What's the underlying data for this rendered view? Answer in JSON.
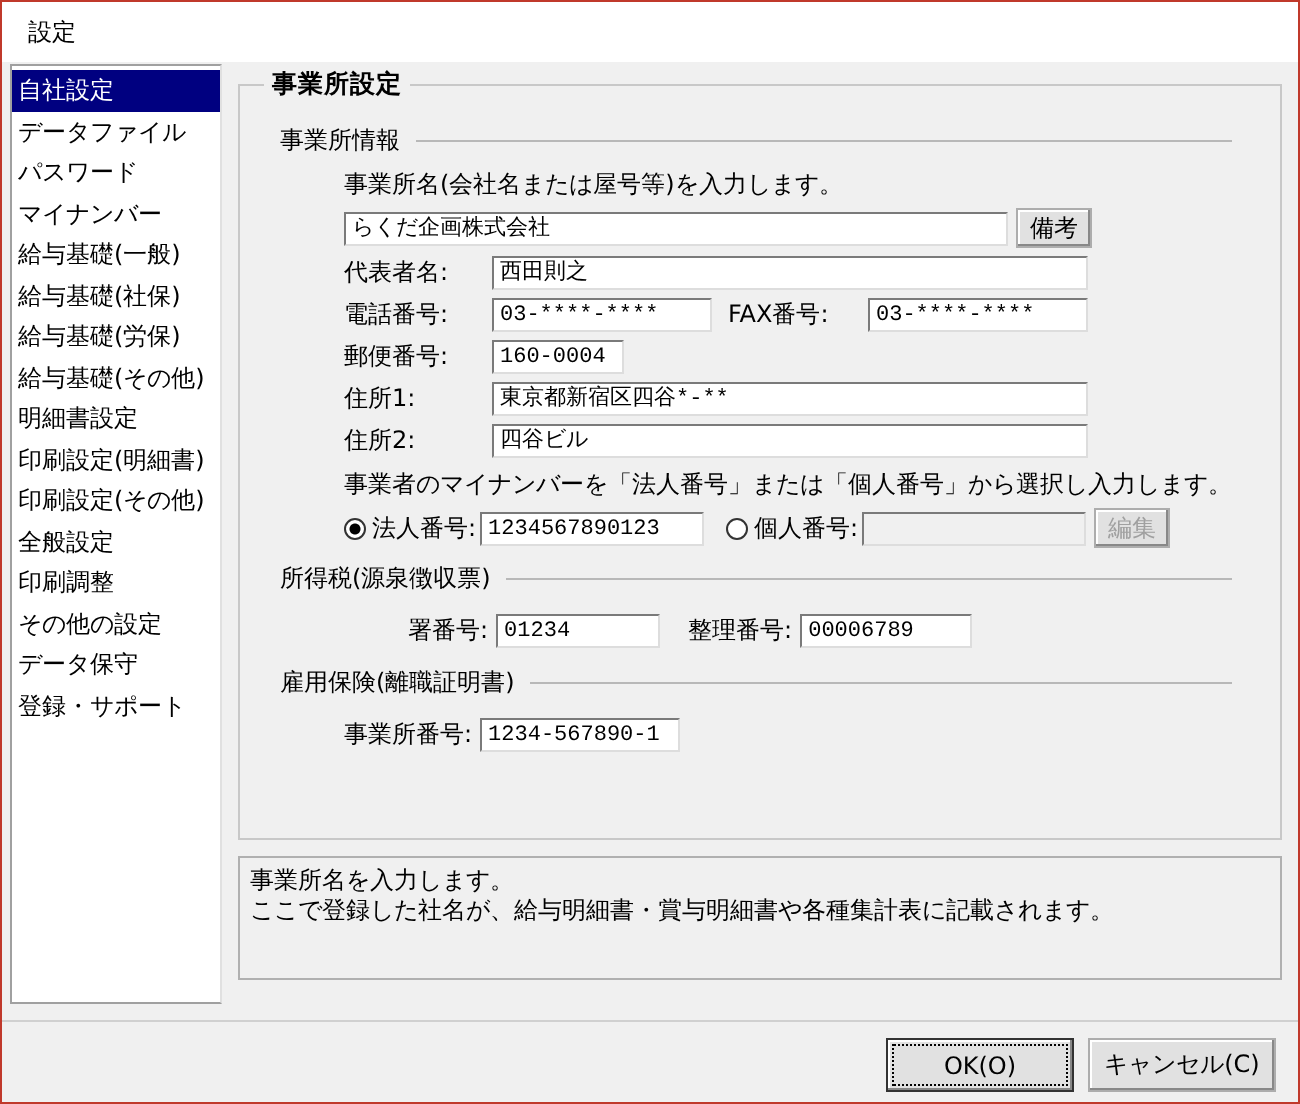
{
  "window": {
    "title": "設定"
  },
  "sidebar": {
    "items": [
      {
        "label": "自社設定",
        "selected": true
      },
      {
        "label": "データファイル",
        "selected": false
      },
      {
        "label": "パスワード",
        "selected": false
      },
      {
        "label": "マイナンバー",
        "selected": false
      },
      {
        "label": "給与基礎(一般)",
        "selected": false
      },
      {
        "label": "給与基礎(社保)",
        "selected": false
      },
      {
        "label": "給与基礎(労保)",
        "selected": false
      },
      {
        "label": "給与基礎(その他)",
        "selected": false
      },
      {
        "label": "明細書設定",
        "selected": false
      },
      {
        "label": "印刷設定(明細書)",
        "selected": false
      },
      {
        "label": "印刷設定(その他)",
        "selected": false
      },
      {
        "label": "全般設定",
        "selected": false
      },
      {
        "label": "印刷調整",
        "selected": false
      },
      {
        "label": "その他の設定",
        "selected": false
      },
      {
        "label": "データ保守",
        "selected": false
      },
      {
        "label": "登録・サポート",
        "selected": false
      }
    ]
  },
  "panel": {
    "title": "事業所設定"
  },
  "office_info": {
    "heading": "事業所情報",
    "name_prompt": "事業所名(会社名または屋号等)を入力します。",
    "name_value": "らくだ企画株式会社",
    "notes_button": "備考",
    "representative": {
      "label": "代表者名:",
      "value": "西田則之"
    },
    "phone": {
      "label": "電話番号:",
      "value": "03-****-****"
    },
    "fax": {
      "label": "FAX番号:",
      "value": "03-****-****"
    },
    "postal": {
      "label": "郵便番号:",
      "value": "160-0004"
    },
    "address1": {
      "label": "住所1:",
      "value": "東京都新宿区四谷*-**"
    },
    "address2": {
      "label": "住所2:",
      "value": "四谷ビル"
    },
    "mynumber_prompt": "事業者のマイナンバーを「法人番号」または「個人番号」から選択し入力します。",
    "corporate": {
      "label": "法人番号:",
      "value": "1234567890123",
      "selected": true,
      "disabled": false
    },
    "individual": {
      "label": "個人番号:",
      "selected": false,
      "disabled": true
    },
    "edit_button": {
      "label": "編集",
      "disabled": true
    }
  },
  "income_tax": {
    "heading": "所得税(源泉徴収票)",
    "office_no": {
      "label": "署番号:",
      "value": "01234"
    },
    "ref_no": {
      "label": "整理番号:",
      "value": "00006789"
    }
  },
  "employment_insurance": {
    "heading": "雇用保険(離職証明書)",
    "office_no": {
      "label": "事業所番号:",
      "value": "1234-567890-1"
    }
  },
  "description": {
    "lines": [
      "事業所名を入力します。",
      "ここで登録した社名が、給与明細書・賞与明細書や各種集計表に記載されます。"
    ]
  },
  "buttons": [
    {
      "label": "OK(O)",
      "default": true
    },
    {
      "label": "キャンセル(C)",
      "default": false
    }
  ]
}
